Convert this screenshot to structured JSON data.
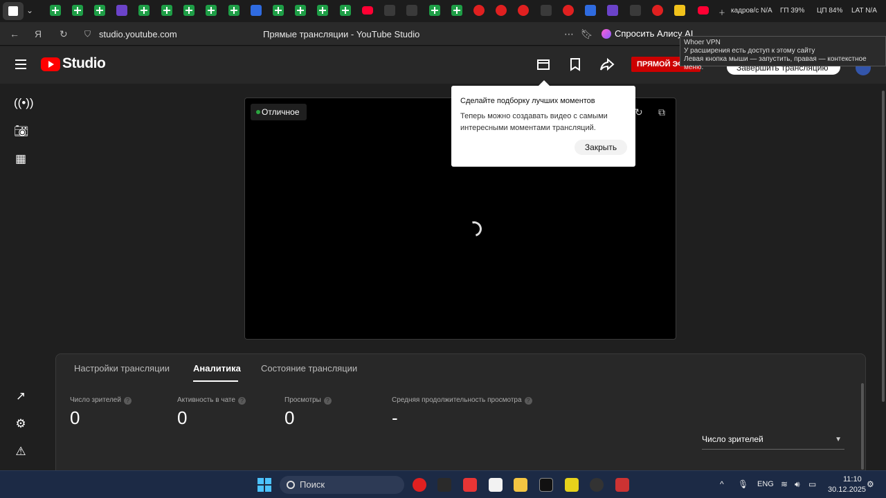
{
  "browser": {
    "url": "studio.youtube.com",
    "page_title": "Прямые трансляции - YouTube Studio",
    "ask_alice": "Спросить Алису AI",
    "tray_status": "кадров/с N/A",
    "tray_gpu": "ГП 39%",
    "tray_cpu": "ЦП 84%",
    "tray_lat": "LAT N/A"
  },
  "vpn_tooltip": {
    "title": "Whoer VPN",
    "line1": "У расширения есть доступ к этому сайту",
    "line2": "Левая кнопка мыши — запустить, правая — контекстное меню."
  },
  "header": {
    "logo_text": "Studio",
    "live_badge": "ПРЯМОЙ ЭФИР",
    "end_stream": "Завершить трансляцию"
  },
  "preview": {
    "quality": "Отличное"
  },
  "popup": {
    "title": "Сделайте подборку лучших моментов",
    "text": "Теперь можно создавать видео с самыми интересными моментами трансляций.",
    "close": "Закрыть"
  },
  "panel": {
    "tabs": [
      {
        "label": "Настройки трансляции"
      },
      {
        "label": "Аналитика"
      },
      {
        "label": "Состояние трансляции"
      }
    ],
    "metrics": [
      {
        "label": "Число зрителей",
        "value": "0"
      },
      {
        "label": "Активность в чате",
        "value": "0"
      },
      {
        "label": "Просмотры",
        "value": "0"
      },
      {
        "label": "Средняя продолжительность просмотра",
        "value": "-"
      }
    ],
    "select_value": "Число зрителей"
  },
  "taskbar": {
    "search": "Поиск",
    "lang": "ENG",
    "time": "11:10",
    "date": "30.12.2025"
  }
}
